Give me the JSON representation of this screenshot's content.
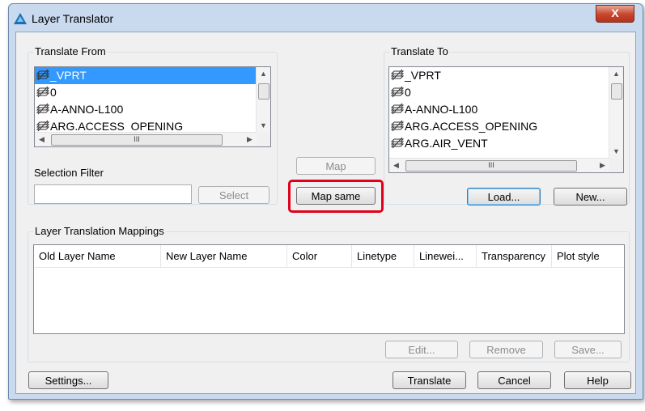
{
  "window": {
    "title": "Layer Translator",
    "close_label": "X"
  },
  "translate_from": {
    "group_label": "Translate From",
    "layers": [
      "_VPRT",
      "0",
      "A-ANNO-L100",
      "ARG.ACCESS_OPENING"
    ],
    "selected_index": 0,
    "hscroll_thumb_glyph": "III"
  },
  "translate_to": {
    "group_label": "Translate To",
    "layers": [
      "_VPRT",
      "0",
      "A-ANNO-L100",
      "ARG.ACCESS_OPENING",
      "ARG.AIR_VENT"
    ],
    "hscroll_thumb_glyph": "III"
  },
  "selection_filter": {
    "label": "Selection Filter",
    "value": "",
    "select_label": "Select"
  },
  "center": {
    "map_label": "Map",
    "map_same_label": "Map same"
  },
  "to_buttons": {
    "load_label": "Load...",
    "new_label": "New..."
  },
  "mappings": {
    "group_label": "Layer Translation Mappings",
    "columns": [
      "Old Layer Name",
      "New Layer Name",
      "Color",
      "Linetype",
      "Linewei...",
      "Transparency",
      "Plot style"
    ],
    "rows": [],
    "edit_label": "Edit...",
    "remove_label": "Remove",
    "save_label": "Save..."
  },
  "footer": {
    "settings_label": "Settings...",
    "translate_label": "Translate",
    "cancel_label": "Cancel",
    "help_label": "Help"
  },
  "colors": {
    "highlight": "#e0001b",
    "selection": "#3399ff",
    "window_frame": "#c9d9ee"
  }
}
